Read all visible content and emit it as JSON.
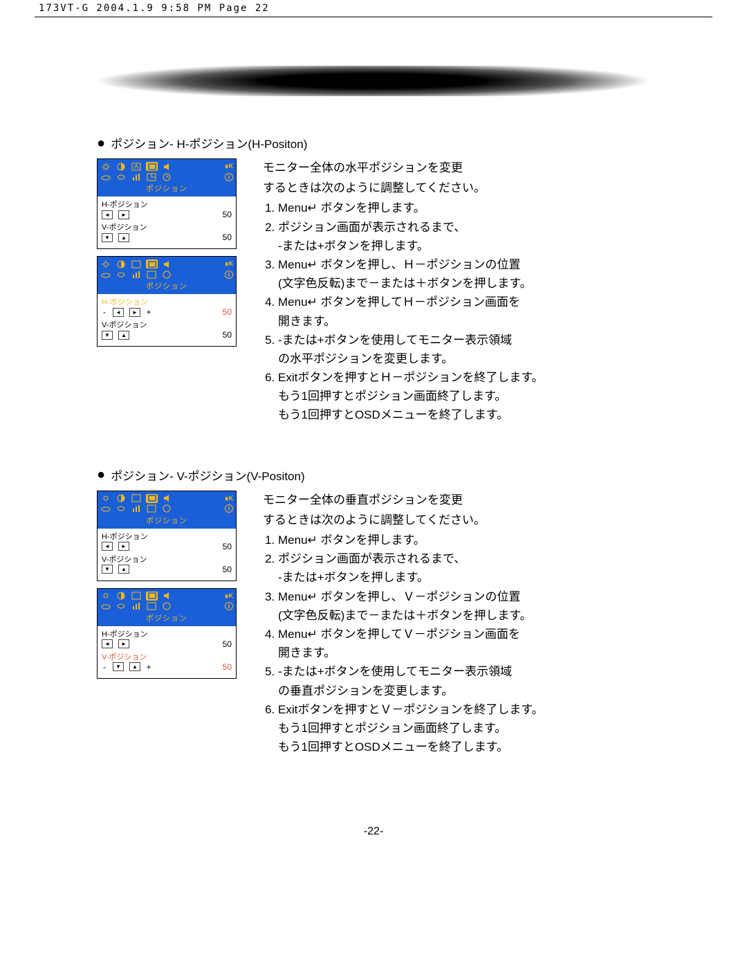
{
  "header": "173VT-G  2004.1.9 9:58 PM  Page 22",
  "section_h": {
    "bullet_title": "ポジション- H-ポジション(H-Positon)",
    "osd_title": "ポジション",
    "h_label": "H-ポジション",
    "v_label": "V-ポジション",
    "val_h1": "50",
    "val_v1": "50",
    "val_h2": "50",
    "val_v2": "50",
    "intro1": "モニター全体の水平ポジションを変更",
    "intro2": "するときは次のように調整してください。",
    "steps": [
      "Menu↵ ボタンを押します。",
      "ポジション画面が表示されるまで、<br>-または+ボタンを押します。",
      "Menu↵ ボタンを押し、Ｈ－ポジションの位置<br>(文字色反転)まで－または＋ボタンを押します。",
      "Menu↵ ボタンを押してＨ－ポジション画面を<br>開きます。",
      "-または+ボタンを使用してモニター表示領域<br>の水平ポジションを変更します。",
      "Exitボタンを押すとＨ－ポジションを終了します。<br>もう1回押すとポジション画面終了します。<br>もう1回押すとOSDメニューを終了します。"
    ]
  },
  "section_v": {
    "bullet_title": "ポジション- V-ポジション(V-Positon)",
    "osd_title": "ポジション",
    "h_label": "H-ポジション",
    "v_label": "V-ポジション",
    "val_h1": "50",
    "val_v1": "50",
    "val_h2": "50",
    "val_v2": "50",
    "intro1": "モニター全体の垂直ポジションを変更",
    "intro2": "するときは次のように調整してください。",
    "steps": [
      "Menu↵ ボタンを押します。",
      "ポジション画面が表示されるまで、<br>-または+ボタンを押します。",
      "Menu↵ ボタンを押し、Ｖ－ポジションの位置<br>(文字色反転)まで－または＋ボタンを押します。",
      "Menu↵ ボタンを押してＶ－ポジション画面を<br>開きます。",
      "-または+ボタンを使用してモニター表示領域<br>の垂直ポジションを変更します。",
      "Exitボタンを押すとＶ－ポジションを終了します。<br>もう1回押すとポジション画面終了します。<br>もう1回押すとOSDメニューを終了します。"
    ]
  },
  "page_number": "-22-"
}
